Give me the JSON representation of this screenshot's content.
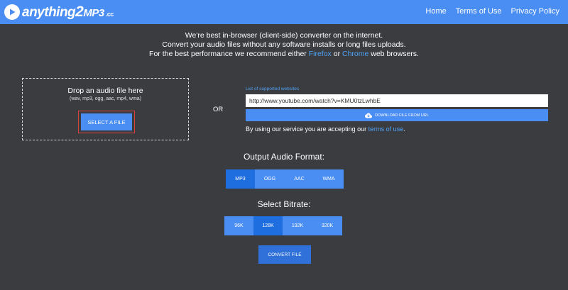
{
  "header": {
    "logo": {
      "part1": "anything",
      "part2": "2",
      "part3": "MP3",
      "part4": ".cc"
    },
    "nav": [
      "Home",
      "Terms of Use",
      "Privacy Policy"
    ]
  },
  "intro": {
    "line1": "We're best in-browser (client-side) converter on the internet.",
    "line2": "Convert your audio files without any software installs or long files uploads.",
    "line3_pre": "For the best performance we recommend either ",
    "firefox": "Firefox",
    "line3_mid": " or ",
    "chrome": "Chrome",
    "line3_post": " web browsers."
  },
  "dropzone": {
    "title": "Drop an audio file here",
    "formats": "(wav, mp3, ogg, aac, mp4, wma)",
    "select_label": "SELECT A FILE"
  },
  "or_label": "OR",
  "url": {
    "supported_link": "List of supported websites",
    "value": "http://www.youtube.com/watch?v=KMU0tzLwhbE",
    "download_label": "DOWNLOAD FILE FROM URL",
    "terms_pre": "By using our service you are accepting our ",
    "terms_link": "terms of use",
    "terms_post": "."
  },
  "output_format": {
    "title": "Output Audio Format:",
    "options": [
      "MP3",
      "OGG",
      "AAC",
      "WMA"
    ],
    "selected": "MP3"
  },
  "bitrate": {
    "title": "Select Bitrate:",
    "options": [
      "96K",
      "128K",
      "192K",
      "320K"
    ],
    "selected": "128K"
  },
  "convert_label": "CONVERT FILE",
  "colors": {
    "header": "#4a8ef3",
    "background": "#3a3c40",
    "accent": "#4a8ef3",
    "active": "#1f6ee0",
    "link": "#4fa3f7",
    "highlight_border": "#d9433a"
  },
  "icons": {
    "logo": "play-circle-icon",
    "download": "cloud-download-icon"
  }
}
